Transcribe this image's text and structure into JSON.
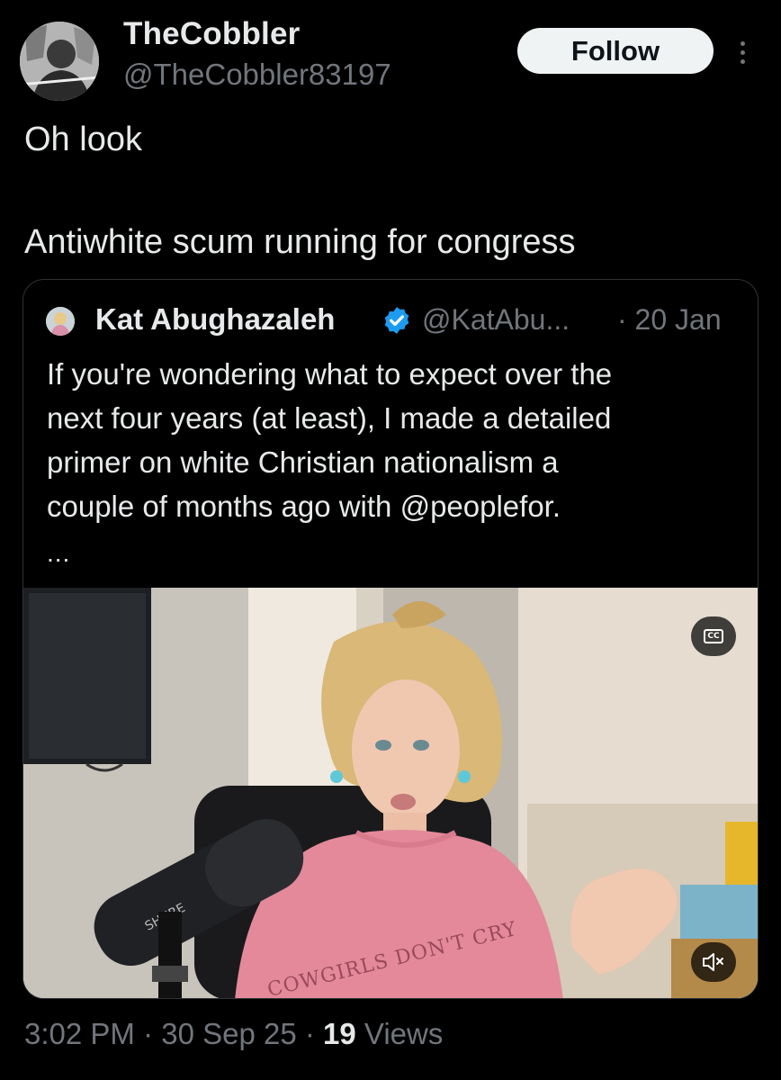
{
  "author": {
    "name": "TheCobbler",
    "handle": "@TheCobbler83197",
    "follow_label": "Follow"
  },
  "tweet": {
    "lines": [
      "Oh look",
      "Antiwhite scum running for congress"
    ]
  },
  "quoted": {
    "name": "Kat Abughazaleh",
    "handle": "@KatAbu...",
    "date": "· 20 Jan",
    "body_lines": [
      "If you're wondering what to expect over the",
      "next four years (at least), I made a detailed",
      "primer on white Christian nationalism a",
      "couple of months ago with @peoplefor."
    ],
    "more": "...",
    "video": {
      "shirt_text": "COWGIRLS DON'T CRY"
    }
  },
  "meta": {
    "time": "3:02 PM",
    "sep1": " · ",
    "date": "30 Sep 25",
    "sep2": " · ",
    "views_count": "19",
    "views_label": " Views"
  },
  "colors": {
    "background": "#000000",
    "primary_text": "#e7e9ea",
    "secondary_text": "#71767b",
    "verified": "#1d9bf0",
    "follow_bg": "#eff3f4"
  },
  "icons": [
    "more-icon",
    "verified-badge-icon",
    "closed-captions-icon",
    "muted-speaker-icon"
  ]
}
